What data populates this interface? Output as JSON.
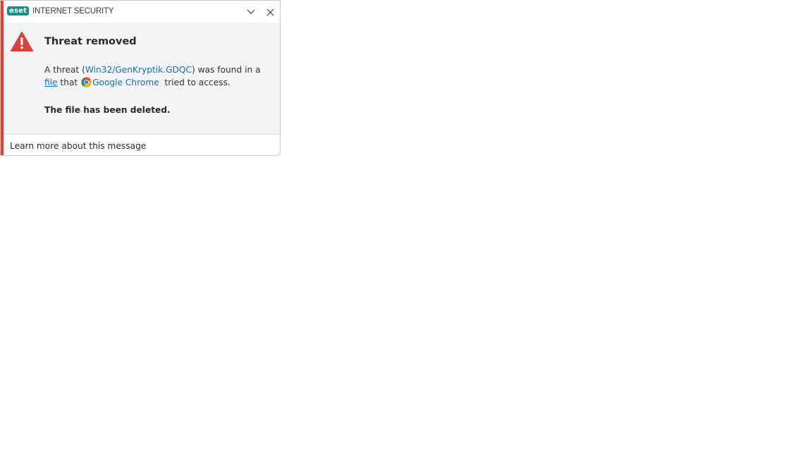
{
  "window": {
    "brand_logo": "eset",
    "brand_name": "INTERNET SECURITY",
    "collapse_icon": "chevron-down-icon",
    "close_icon": "close-icon"
  },
  "notification": {
    "accent_color": "#d9423b",
    "icon": "warning-triangle-icon",
    "title": "Threat removed",
    "message": {
      "part1": "A threat (",
      "threat_name": "Win32/GenKryptik.GDQC",
      "part2": ") was found in a",
      "file_link": "file",
      "part3": " that ",
      "app_icon": "chrome-icon",
      "app_name": "Google Chrome",
      "part4": "  tried to access."
    },
    "result": "The file has been deleted."
  },
  "footer": {
    "learn_more": "Learn more about this message"
  }
}
